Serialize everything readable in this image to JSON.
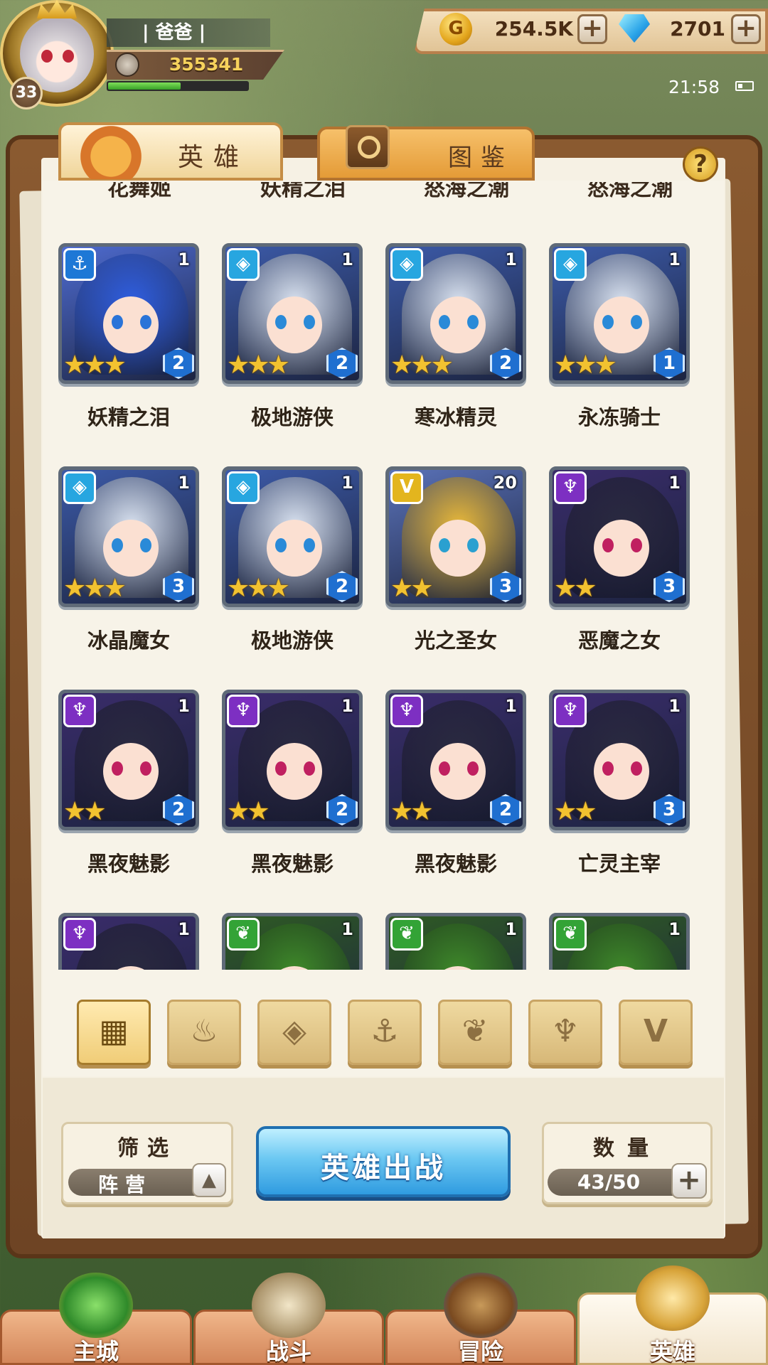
{
  "player": {
    "name": "| 爸爸 |",
    "power": "355341",
    "level": "33",
    "exp_progress": 0.52
  },
  "resources": {
    "gold": "254.5K",
    "gems": "2701",
    "plus": "+"
  },
  "status": {
    "time": "21:58"
  },
  "tabs": {
    "hero": "英雄",
    "codex": "图鉴",
    "help": "?"
  },
  "partial_row": [
    "花舞姬",
    "妖精之泪",
    "怒海之潮",
    "怒海之潮"
  ],
  "heroes": [
    {
      "name": "妖精之泪",
      "faction": "water",
      "faction_glyph": "⚓",
      "level": "1",
      "stars": "★★★",
      "rank": "2"
    },
    {
      "name": "极地游侠",
      "faction": "ice",
      "faction_glyph": "◈",
      "level": "1",
      "stars": "★★★",
      "rank": "2"
    },
    {
      "name": "寒冰精灵",
      "faction": "ice",
      "faction_glyph": "◈",
      "level": "1",
      "stars": "★★★",
      "rank": "2"
    },
    {
      "name": "永冻骑士",
      "faction": "ice",
      "faction_glyph": "◈",
      "level": "1",
      "stars": "★★★",
      "rank": "1"
    },
    {
      "name": "冰晶魔女",
      "faction": "ice",
      "faction_glyph": "◈",
      "level": "1",
      "stars": "★★★",
      "rank": "3"
    },
    {
      "name": "极地游侠",
      "faction": "ice",
      "faction_glyph": "◈",
      "level": "1",
      "stars": "★★★",
      "rank": "2"
    },
    {
      "name": "光之圣女",
      "faction": "light",
      "faction_glyph": "V",
      "level": "20",
      "stars": "★★",
      "rank": "3"
    },
    {
      "name": "恶魔之女",
      "faction": "dark",
      "faction_glyph": "♆",
      "level": "1",
      "stars": "★★",
      "rank": "3"
    },
    {
      "name": "黑夜魅影",
      "faction": "dark",
      "faction_glyph": "♆",
      "level": "1",
      "stars": "★★",
      "rank": "2"
    },
    {
      "name": "黑夜魅影",
      "faction": "dark",
      "faction_glyph": "♆",
      "level": "1",
      "stars": "★★",
      "rank": "2"
    },
    {
      "name": "黑夜魅影",
      "faction": "dark",
      "faction_glyph": "♆",
      "level": "1",
      "stars": "★★",
      "rank": "2"
    },
    {
      "name": "亡灵主宰",
      "faction": "dark",
      "faction_glyph": "♆",
      "level": "1",
      "stars": "★★",
      "rank": "3"
    },
    {
      "name": "",
      "faction": "dark",
      "faction_glyph": "♆",
      "level": "1",
      "stars": "",
      "rank": ""
    },
    {
      "name": "",
      "faction": "nature",
      "faction_glyph": "❦",
      "level": "1",
      "stars": "",
      "rank": ""
    },
    {
      "name": "",
      "faction": "nature",
      "faction_glyph": "❦",
      "level": "1",
      "stars": "",
      "rank": ""
    },
    {
      "name": "",
      "faction": "nature",
      "faction_glyph": "❦",
      "level": "1",
      "stars": "",
      "rank": ""
    }
  ],
  "faction_filters": [
    {
      "icon": "all-grid-icon",
      "glyph": "▦"
    },
    {
      "icon": "fire-faction-icon",
      "glyph": "♨"
    },
    {
      "icon": "ice-faction-icon",
      "glyph": "◈"
    },
    {
      "icon": "water-faction-icon",
      "glyph": "⚓"
    },
    {
      "icon": "nature-faction-icon",
      "glyph": "❦"
    },
    {
      "icon": "dark-faction-icon",
      "glyph": "♆"
    },
    {
      "icon": "light-faction-icon",
      "glyph": "V"
    }
  ],
  "filter": {
    "title": "筛选",
    "value": "阵营",
    "arrow": "▲"
  },
  "deploy_button": "英雄出战",
  "count": {
    "title": "数量",
    "value": "43/50",
    "plus": "+"
  },
  "nav": [
    {
      "label": "主城",
      "icon": "main-city-icon"
    },
    {
      "label": "战斗",
      "icon": "crossed-swords-icon"
    },
    {
      "label": "冒险",
      "icon": "adventure-map-icon"
    },
    {
      "label": "英雄",
      "icon": "hero-helmet-icon"
    }
  ],
  "colors": {
    "water": "#1e78d6",
    "ice": "#27a6e0",
    "light": "#e3b51e",
    "dark": "#7d2fc2",
    "nature": "#33a336",
    "deploy_button": "#2f9be0"
  }
}
